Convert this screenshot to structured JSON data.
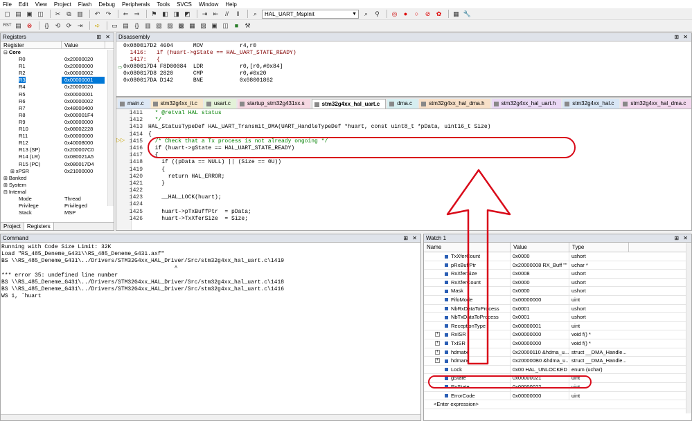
{
  "menu": [
    "File",
    "Edit",
    "View",
    "Project",
    "Flash",
    "Debug",
    "Peripherals",
    "Tools",
    "SVCS",
    "Window",
    "Help"
  ],
  "toolbar": {
    "function_combo": "HAL_UART_MspInit"
  },
  "registers": {
    "title": "Registers",
    "col_register": "Register",
    "col_value": "Value",
    "rows": [
      {
        "name": "Core",
        "value": "",
        "indent": 0,
        "expand": "−"
      },
      {
        "name": "R0",
        "value": "0x20000020",
        "indent": 2
      },
      {
        "name": "R1",
        "value": "0x20000000",
        "indent": 2
      },
      {
        "name": "R2",
        "value": "0x00000002",
        "indent": 2
      },
      {
        "name": "R3",
        "value": "0x00000001",
        "indent": 2,
        "selected": true
      },
      {
        "name": "R4",
        "value": "0x20000020",
        "indent": 2
      },
      {
        "name": "R5",
        "value": "0x00000001",
        "indent": 2
      },
      {
        "name": "R6",
        "value": "0x00000002",
        "indent": 2
      },
      {
        "name": "R7",
        "value": "0x48000400",
        "indent": 2
      },
      {
        "name": "R8",
        "value": "0x000001F4",
        "indent": 2
      },
      {
        "name": "R9",
        "value": "0x00000000",
        "indent": 2
      },
      {
        "name": "R10",
        "value": "0x08002228",
        "indent": 2
      },
      {
        "name": "R11",
        "value": "0x00000000",
        "indent": 2
      },
      {
        "name": "R12",
        "value": "0x40008000",
        "indent": 2
      },
      {
        "name": "R13 (SP)",
        "value": "0x200007C0",
        "indent": 2
      },
      {
        "name": "R14 (LR)",
        "value": "0x080021A5",
        "indent": 2
      },
      {
        "name": "R15 (PC)",
        "value": "0x080017D4",
        "indent": 2
      },
      {
        "name": "xPSR",
        "value": "0x21000000",
        "indent": 2,
        "expand": "+"
      },
      {
        "name": "Banked",
        "value": "",
        "indent": 0,
        "expand": "+"
      },
      {
        "name": "System",
        "value": "",
        "indent": 0,
        "expand": "+"
      },
      {
        "name": "Internal",
        "value": "",
        "indent": 0,
        "expand": "−"
      },
      {
        "name": "Mode",
        "value": "Thread",
        "indent": 2
      },
      {
        "name": "Privilege",
        "value": "Privileged",
        "indent": 2
      },
      {
        "name": "Stack",
        "value": "MSP",
        "indent": 2
      }
    ],
    "tabs": [
      "Project",
      "Registers"
    ]
  },
  "disassembly": {
    "title": "Disassembly",
    "lines": [
      {
        "text": "0x080017D2 4604      MOV           r4,r0",
        "src": false
      },
      {
        "text": "  1416:   if (huart->gState == HAL_UART_STATE_READY)",
        "src": true
      },
      {
        "text": "  1417:   {",
        "src": true
      },
      {
        "text": "0x080017D4 F8D00084  LDR           r0,[r0,#0x84]",
        "src": false
      },
      {
        "text": "0x080017D8 2820      CMP           r0,#0x20",
        "src": false
      },
      {
        "text": "0x080017DA D142      BNE           0x08001862",
        "src": false
      }
    ]
  },
  "editor": {
    "tabs": [
      "main.c",
      "stm32g4xx_it.c",
      "usart.c",
      "startup_stm32g431xx.s",
      "stm32g4xx_hal_uart.c",
      "dma.c",
      "stm32g4xx_hal_dma.h",
      "stm32g4xx_hal_uart.h",
      "stm32g4xx_hal.c",
      "stm32g4xx_hal_dma.c"
    ],
    "active_tab": "stm32g4xx_hal_uart.c",
    "lines": [
      {
        "n": "1411",
        "t": "  * @retval HAL status",
        "comment": true
      },
      {
        "n": "1412",
        "t": "  */",
        "comment": true
      },
      {
        "n": "1413",
        "t": "HAL_StatusTypeDef HAL_UART_Transmit_DMA(UART_HandleTypeDef *huart, const uint8_t *pData, uint16_t Size)",
        "comment": false
      },
      {
        "n": "1414",
        "t": "{",
        "comment": false
      },
      {
        "n": "1415",
        "t": "  /* Check that a Tx process is not already ongoing */",
        "comment": true
      },
      {
        "n": "1416",
        "t": "  if (huart->gState == HAL_UART_STATE_READY)",
        "comment": false
      },
      {
        "n": "1417",
        "t": "  {",
        "comment": false
      },
      {
        "n": "1418",
        "t": "    if ((pData == NULL) || (Size == 0U))",
        "comment": false
      },
      {
        "n": "1419",
        "t": "    {",
        "comment": false
      },
      {
        "n": "1420",
        "t": "      return HAL_ERROR;",
        "comment": false
      },
      {
        "n": "1421",
        "t": "    }",
        "comment": false
      },
      {
        "n": "1422",
        "t": "",
        "comment": false
      },
      {
        "n": "1423",
        "t": "    __HAL_LOCK(huart);",
        "comment": false
      },
      {
        "n": "1424",
        "t": "",
        "comment": false
      },
      {
        "n": "1425",
        "t": "    huart->pTxBuffPtr  = pData;",
        "comment": false
      },
      {
        "n": "1426",
        "t": "    huart->TxXferSize  = Size;",
        "comment": false
      }
    ]
  },
  "command": {
    "title": "Command",
    "lines": [
      "Running with Code Size Limit: 32K",
      "Load \"RS_485_Deneme_G431\\\\RS_485_Deneme_G431.axf\"",
      "BS \\\\RS_485_Deneme_G431\\../Drivers/STM32G4xx_HAL_Driver/Src/stm32g4xx_hal_uart.c\\1419",
      "                                                    ^",
      "*** error 35: undefined line number",
      "BS \\\\RS_485_Deneme_G431\\../Drivers/STM32G4xx_HAL_Driver/Src/stm32g4xx_hal_uart.c\\1418",
      "BS \\\\RS_485_Deneme_G431\\../Drivers/STM32G4xx_HAL_Driver/Src/stm32g4xx_hal_uart.c\\1416",
      "WS 1, `huart"
    ]
  },
  "watch": {
    "title": "Watch 1",
    "col_name": "Name",
    "col_value": "Value",
    "col_type": "Type",
    "rows": [
      {
        "name": "TxXferCount",
        "value": "0x0000",
        "type": "ushort"
      },
      {
        "name": "pRxBuffPtr",
        "value": "0x20000008 RX_Buff \"\"",
        "type": "uchar *"
      },
      {
        "name": "RxXferSize",
        "value": "0x0008",
        "type": "ushort"
      },
      {
        "name": "RxXferCount",
        "value": "0x0000",
        "type": "ushort"
      },
      {
        "name": "Mask",
        "value": "0x0000",
        "type": "ushort"
      },
      {
        "name": "FifoMode",
        "value": "0x00000000",
        "type": "uint"
      },
      {
        "name": "NbRxDataToProcess",
        "value": "0x0001",
        "type": "ushort"
      },
      {
        "name": "NbTxDataToProcess",
        "value": "0x0001",
        "type": "ushort"
      },
      {
        "name": "ReceptionType",
        "value": "0x00000001",
        "type": "uint"
      },
      {
        "name": "RxISR",
        "value": "0x00000000",
        "type": "void f()  *",
        "expand": "+"
      },
      {
        "name": "TxISR",
        "value": "0x00000000",
        "type": "void f()  *",
        "expand": "+"
      },
      {
        "name": "hdmatx",
        "value": "0x20000110 &hdma_u...",
        "type": "struct __DMA_Handle...",
        "expand": "+"
      },
      {
        "name": "hdmarx",
        "value": "0x200000B0 &hdma_u...",
        "type": "struct __DMA_Handle...",
        "expand": "+"
      },
      {
        "name": "Lock",
        "value": "0x00 HAL_UNLOCKED",
        "type": "enum (uchar)"
      },
      {
        "name": "gState",
        "value": "0x00000021",
        "type": "uint"
      },
      {
        "name": "RxState",
        "value": "0x00000022",
        "type": "uint"
      },
      {
        "name": "ErrorCode",
        "value": "0x00000000",
        "type": "uint"
      }
    ],
    "enter_expression": "<Enter expression>"
  },
  "colors": {
    "annotation_red": "#d90b1a",
    "selection_blue": "#0078d7",
    "comment_green": "#008000"
  }
}
